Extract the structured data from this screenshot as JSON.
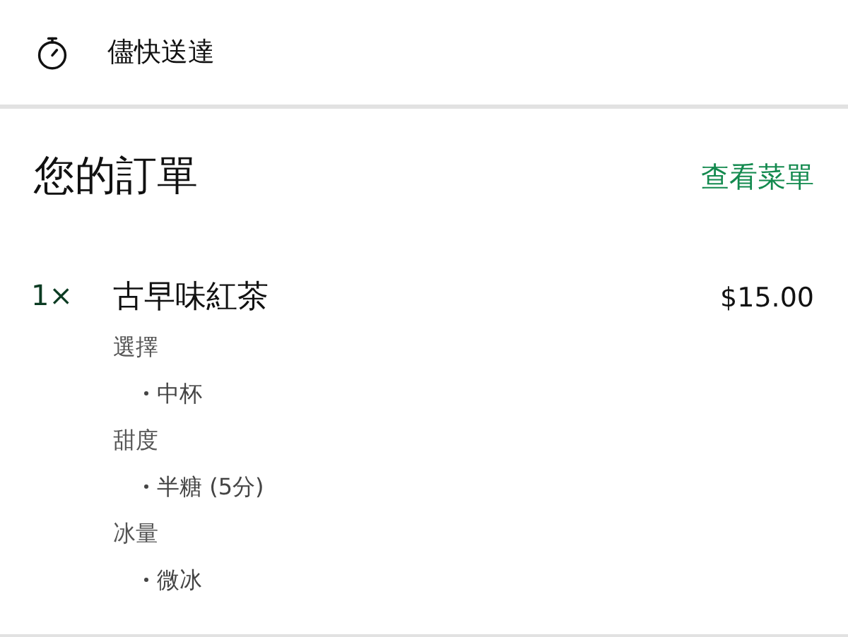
{
  "delivery": {
    "label": "儘快送達"
  },
  "order": {
    "title": "您的訂單",
    "menu_link": "查看菜單"
  },
  "items": [
    {
      "quantity": "1×",
      "name": "古早味紅茶",
      "price": "$15.00",
      "options": [
        {
          "label": "選擇",
          "choices": [
            "中杯"
          ]
        },
        {
          "label": "甜度",
          "choices": [
            "半糖 (5分)"
          ]
        },
        {
          "label": "冰量",
          "choices": [
            "微冰"
          ]
        }
      ]
    }
  ]
}
